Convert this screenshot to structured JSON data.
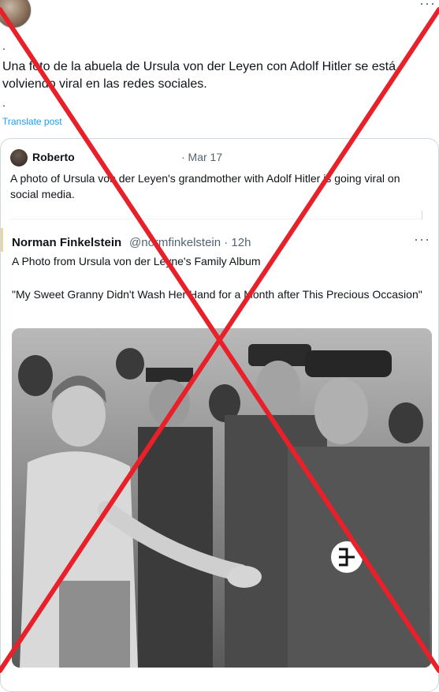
{
  "post": {
    "dot_top": ".",
    "text": "Una foto de la abuela de Ursula von der Leyen con Adolf Hitler se está volviendo viral en las redes sociales.",
    "dot_bottom": ".",
    "translate_label": "Translate post",
    "more_icon": "more-horizontal-icon"
  },
  "quoted": {
    "author": "Roberto",
    "date": "· Mar 17",
    "text": "A photo of Ursula von der Leyen's grandmother with Adolf Hitler is going viral on social media."
  },
  "nested": {
    "author": "Norman Finkelstein",
    "handle": "@normfinkelstein · 12h",
    "line1": "A Photo from Ursula von der Leyne's Family Album",
    "quote": "\"My Sweet Granny Didn't Wash Her Hand for a Month after This Precious Occasion\""
  },
  "overlay": {
    "color": "#e8202a"
  }
}
